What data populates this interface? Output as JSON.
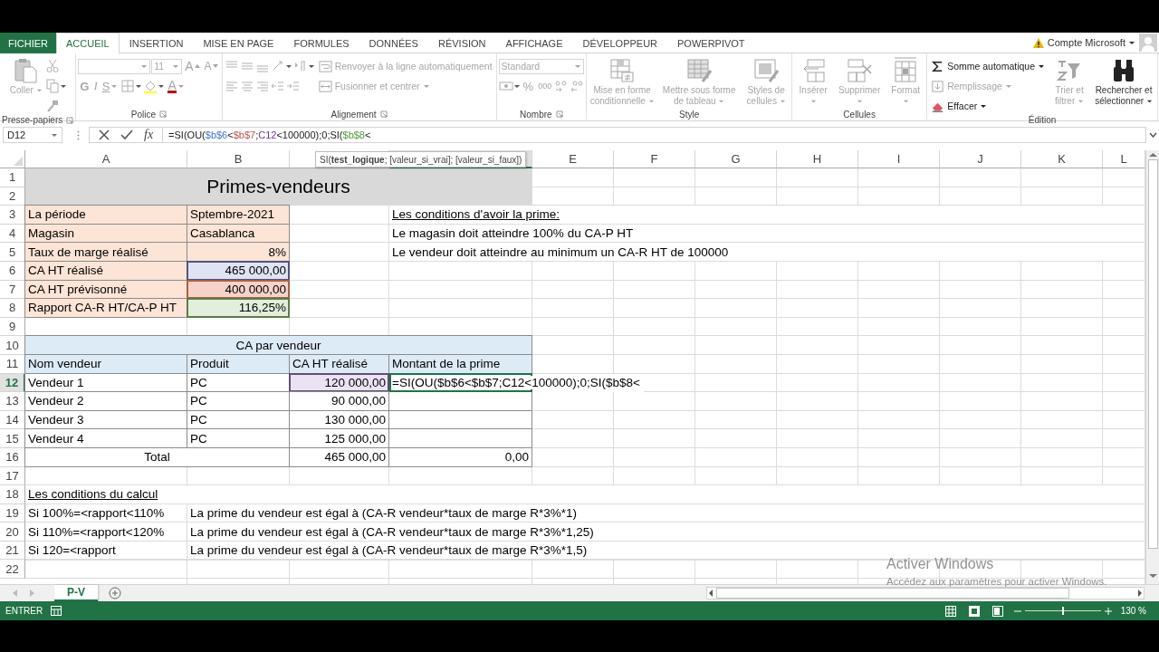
{
  "ribbon": {
    "tabs": [
      {
        "label": "FICHIER",
        "kind": "file",
        "selected": false
      },
      {
        "label": "ACCUEIL",
        "kind": "tab",
        "selected": true
      },
      {
        "label": "INSERTION",
        "kind": "tab",
        "selected": false
      },
      {
        "label": "MISE EN PAGE",
        "kind": "tab",
        "selected": false
      },
      {
        "label": "FORMULES",
        "kind": "tab",
        "selected": false
      },
      {
        "label": "DONNÉES",
        "kind": "tab",
        "selected": false
      },
      {
        "label": "RÉVISION",
        "kind": "tab",
        "selected": false
      },
      {
        "label": "AFFICHAGE",
        "kind": "tab",
        "selected": false
      },
      {
        "label": "DÉVELOPPEUR",
        "kind": "tab",
        "selected": false
      },
      {
        "label": "POWERPIVOT",
        "kind": "tab",
        "selected": false
      }
    ],
    "account": {
      "label": "Compte Microsoft"
    },
    "groups": [
      {
        "name": "Presse-papiers",
        "launcher": true,
        "blocks": [
          {
            "kind": "large",
            "label": "Coller",
            "disabled": true,
            "dropdown": true
          },
          {
            "kind": "rows",
            "rows": [
              [
                {
                  "kind": "icon",
                  "disabled": true
                }
              ],
              [
                {
                  "kind": "icon",
                  "disabled": true,
                  "dropdown": true
                }
              ],
              [
                {
                  "kind": "icon",
                  "disabled": true
                }
              ]
            ]
          }
        ]
      },
      {
        "name": "Police",
        "launcher": true,
        "blocks": [
          {
            "kind": "rows",
            "rows": [
              [
                {
                  "kind": "field",
                  "disabled": true
                },
                {
                  "kind": "field",
                  "value": "11",
                  "disabled": true
                },
                {
                  "kind": "glyph",
                  "label": "A",
                  "disabled": true
                },
                {
                  "kind": "glyph",
                  "label": "A",
                  "disabled": true
                }
              ],
              [
                {
                  "kind": "glyph",
                  "label": "G",
                  "disabled": true
                },
                {
                  "kind": "glyph",
                  "label": "I",
                  "disabled": true
                },
                {
                  "kind": "glyph",
                  "label": "S",
                  "disabled": true,
                  "dropdown": true
                },
                {
                  "kind": "icon",
                  "disabled": true,
                  "dropdown": true
                },
                {
                  "kind": "icon",
                  "disabled": true,
                  "dropdown": true
                },
                {
                  "kind": "glyph",
                  "label": "A",
                  "disabled": true,
                  "dropdown": true
                }
              ]
            ]
          }
        ]
      },
      {
        "name": "Alignement",
        "launcher": true,
        "blocks": [
          {
            "kind": "rows",
            "rows": [
              [
                {
                  "kind": "icon",
                  "disabled": true
                },
                {
                  "kind": "icon",
                  "disabled": true
                },
                {
                  "kind": "icon",
                  "disabled": true
                },
                {
                  "kind": "icon",
                  "disabled": true,
                  "dropdown": true
                },
                {
                  "kind": "icon",
                  "disabled": true,
                  "dropdown": true
                }
              ],
              [
                {
                  "kind": "icon",
                  "disabled": true
                },
                {
                  "kind": "icon",
                  "disabled": true
                },
                {
                  "kind": "icon",
                  "disabled": true
                },
                {
                  "kind": "icon",
                  "disabled": true
                },
                {
                  "kind": "icon",
                  "disabled": true
                }
              ]
            ]
          },
          {
            "kind": "rows",
            "rows": [
              [
                {
                  "kind": "button",
                  "label": "Renvoyer à la ligne automatiquement",
                  "disabled": true
                }
              ],
              [
                {
                  "kind": "button",
                  "label": "Fusionner et centrer",
                  "disabled": true,
                  "dropdown": true
                }
              ]
            ]
          }
        ]
      },
      {
        "name": "Nombre",
        "launcher": true,
        "blocks": [
          {
            "kind": "rows",
            "rows": [
              [
                {
                  "kind": "field",
                  "value": "Standard",
                  "disabled": true
                }
              ],
              [
                {
                  "kind": "icon",
                  "disabled": true,
                  "dropdown": true
                },
                {
                  "kind": "glyph",
                  "label": "%",
                  "disabled": true
                },
                {
                  "kind": "glyph",
                  "label": "000",
                  "disabled": true
                },
                {
                  "kind": "icon",
                  "disabled": true
                },
                {
                  "kind": "icon",
                  "disabled": true
                }
              ]
            ]
          }
        ]
      },
      {
        "name": "Style",
        "launcher": false,
        "blocks": [
          {
            "kind": "large",
            "label": "Mise en forme conditionnelle",
            "disabled": true,
            "dropdown": true
          },
          {
            "kind": "large",
            "label": "Mettre sous forme de tableau",
            "disabled": true,
            "dropdown": true
          },
          {
            "kind": "large",
            "label": "Styles de cellules",
            "disabled": true,
            "dropdown": true
          }
        ]
      },
      {
        "name": "Cellules",
        "launcher": false,
        "blocks": [
          {
            "kind": "large",
            "label": "Insérer",
            "disabled": true,
            "dropdown": true
          },
          {
            "kind": "large",
            "label": "Supprimer",
            "disabled": true,
            "dropdown": true
          },
          {
            "kind": "large",
            "label": "Format",
            "disabled": true,
            "dropdown": true
          }
        ]
      },
      {
        "name": "Édition",
        "launcher": false,
        "blocks": [
          {
            "kind": "rows",
            "rows": [
              [
                {
                  "kind": "button",
                  "label": "Somme automatique",
                  "disabled": false,
                  "dropdown": true
                }
              ],
              [
                {
                  "kind": "button",
                  "label": "Remplissage",
                  "disabled": true,
                  "dropdown": true
                }
              ],
              [
                {
                  "kind": "button",
                  "label": "Effacer",
                  "disabled": false,
                  "dropdown": true
                }
              ]
            ]
          },
          {
            "kind": "large",
            "label": "Trier et filtrer",
            "disabled": true,
            "dropdown": true
          },
          {
            "kind": "large",
            "label": "Rechercher et sélectionner",
            "disabled": false,
            "dropdown": true
          }
        ]
      }
    ]
  },
  "formula_bar": {
    "name_box": "D12",
    "fx": "fx",
    "segments": [
      {
        "text": "=SI(OU("
      },
      {
        "text": "$b$6",
        "color": "#4472c4"
      },
      {
        "text": "<"
      },
      {
        "text": "$b$7",
        "color": "#c0504d"
      },
      {
        "text": ";"
      },
      {
        "text": "C12",
        "color": "#7030a0"
      },
      {
        "text": "<100000);0;SI("
      },
      {
        "text": "$b$8",
        "color": "#4f9a3a"
      },
      {
        "text": "<"
      }
    ]
  },
  "tooltip": "SI(**test_logique**; [valeur_si_vrai]; [valeur_si_faux])",
  "sheet": {
    "columns": [
      {
        "label": "A",
        "selected": false
      },
      {
        "label": "B",
        "selected": false
      },
      {
        "selected": false
      },
      {
        "selected": true
      },
      {
        "label": "E",
        "selected": false
      },
      {
        "label": "F",
        "selected": false
      },
      {
        "label": "G",
        "selected": false
      },
      {
        "label": "H",
        "selected": false
      },
      {
        "label": "I",
        "selected": false
      },
      {
        "label": "J",
        "selected": false
      },
      {
        "label": "K",
        "selected": false
      },
      {
        "label": "L",
        "selected": false
      }
    ],
    "rows": [
      {
        "number": "1",
        "selected": false,
        "cells": [
          {
            "kind": "title",
            "text": "Primes-vendeurs",
            "color": "#d9d9d9",
            "selected": false
          }
        ]
      },
      {
        "number": "2",
        "selected": false
      },
      {
        "number": "3",
        "selected": false,
        "cells": [
          {
            "kind": "boxed",
            "text": "La période",
            "color": "#fce4d6",
            "selected": false
          },
          {
            "kind": "boxed",
            "text": "Sptembre-2021",
            "color": "#fce4d6",
            "selected": false
          },
          {
            "kind": "empty"
          },
          {
            "kind": "note",
            "text": "Les conditions d'avoir la prime:",
            "selected": false
          }
        ]
      },
      {
        "number": "4",
        "selected": false,
        "cells": [
          {
            "kind": "boxed",
            "text": "Magasin",
            "color": "#fce4d6",
            "selected": false
          },
          {
            "kind": "boxed",
            "text": "Casablanca",
            "color": "#fce4d6",
            "selected": false
          },
          {
            "kind": "empty"
          },
          {
            "kind": "text",
            "text": "Le magasin doit atteindre 100% du CA-P HT",
            "selected": false
          }
        ]
      },
      {
        "number": "5",
        "selected": false,
        "cells": [
          {
            "kind": "boxed",
            "text": "Taux de marge réalisé",
            "color": "#fce4d6",
            "selected": false
          },
          {
            "kind": "number",
            "text": "8%",
            "color": "#fce4d6",
            "selected": false
          },
          {
            "kind": "empty"
          },
          {
            "kind": "text",
            "text": "Le vendeur doit atteindre au minimum un CA-R HT de 100000",
            "selected": false
          }
        ]
      },
      {
        "number": "6",
        "selected": false,
        "cells": [
          {
            "kind": "boxed",
            "text": "CA HT réalisé",
            "color": "#fce4d6",
            "selected": false
          },
          {
            "kind": "number",
            "text": "465 000,00",
            "color": "#dfe3f3",
            "highlighted": true,
            "selected": false
          }
        ]
      },
      {
        "number": "7",
        "selected": false,
        "cells": [
          {
            "kind": "boxed",
            "text": "CA HT prévisonné",
            "color": "#fce4d6",
            "selected": false
          },
          {
            "kind": "number",
            "text": "400 000,00",
            "color": "#f6d3c8",
            "highlighted": true,
            "selected": false
          }
        ]
      },
      {
        "number": "8",
        "selected": false,
        "cells": [
          {
            "kind": "boxed",
            "text": "Rapport CA-R HT/CA-P HT",
            "color": "#fce4d6",
            "selected": false
          },
          {
            "kind": "number",
            "text": "116,25%",
            "color": "#e2efda",
            "highlighted": true,
            "selected": false
          }
        ]
      },
      {
        "number": "9",
        "selected": false
      },
      {
        "number": "10",
        "selected": false,
        "cells": [
          {
            "kind": "band",
            "text": "CA par vendeur",
            "color": "#ddebf7",
            "selected": false
          }
        ]
      },
      {
        "number": "11",
        "selected": false,
        "cells": [
          {
            "kind": "boxed",
            "text": "Nom vendeur",
            "color": "#ddebf7",
            "selected": false
          },
          {
            "kind": "boxed",
            "text": "Produit",
            "color": "#ddebf7",
            "selected": false
          },
          {
            "kind": "boxed",
            "text": "CA HT réalisé",
            "color": "#ddebf7",
            "selected": false
          },
          {
            "kind": "boxed",
            "text": "Montant de la prime",
            "color": "#ddebf7",
            "selected": false
          }
        ]
      },
      {
        "number": "12",
        "selected": true,
        "cells": [
          {
            "kind": "boxed",
            "text": "Vendeur 1",
            "selected": false
          },
          {
            "kind": "boxed",
            "text": "PC",
            "selected": false
          },
          {
            "kind": "number",
            "text": "120 000,00",
            "color": "#ebe3f3",
            "highlighted": true,
            "selected": false
          },
          {
            "kind": "boxed",
            "text": "=SI(OU($b$6<$b$7;C12<100000);0;SI($b$8<",
            "selected": true
          }
        ]
      },
      {
        "number": "13",
        "selected": false,
        "cells": [
          {
            "kind": "boxed",
            "text": "Vendeur 2",
            "selected": false
          },
          {
            "kind": "boxed",
            "text": "PC",
            "selected": false
          },
          {
            "kind": "number",
            "text": "90 000,00",
            "selected": false
          },
          {
            "kind": "boxed",
            "selected": false
          }
        ]
      },
      {
        "number": "14",
        "selected": false,
        "cells": [
          {
            "kind": "boxed",
            "text": "Vendeur 3",
            "selected": false
          },
          {
            "kind": "boxed",
            "text": "PC",
            "selected": false
          },
          {
            "kind": "number",
            "text": "130 000,00",
            "selected": false
          },
          {
            "kind": "boxed",
            "selected": false
          }
        ]
      },
      {
        "number": "15",
        "selected": false,
        "cells": [
          {
            "kind": "boxed",
            "text": "Vendeur 4",
            "selected": false
          },
          {
            "kind": "boxed",
            "text": "PC",
            "selected": false
          },
          {
            "kind": "number",
            "text": "125 000,00",
            "selected": false
          },
          {
            "kind": "boxed",
            "selected": false
          }
        ]
      },
      {
        "number": "16",
        "selected": false,
        "cells": [
          {
            "kind": "total",
            "text": "Total",
            "selected": false
          },
          {
            "kind": "number",
            "text": "465 000,00",
            "selected": false
          },
          {
            "kind": "number",
            "text": "0,00",
            "selected": false
          }
        ]
      },
      {
        "number": "17",
        "selected": false
      },
      {
        "number": "18",
        "selected": false,
        "cells": [
          {
            "kind": "note",
            "text": "Les conditions du calcul",
            "selected": false
          }
        ]
      },
      {
        "number": "19",
        "selected": false,
        "cells": [
          {
            "kind": "text",
            "text": "Si 100%=<rapport<110%",
            "selected": false
          },
          {
            "kind": "text",
            "text": "La prime du vendeur est égal à (CA-R vendeur*taux de marge R*3%*1)",
            "selected": false
          }
        ]
      },
      {
        "number": "20",
        "selected": false,
        "cells": [
          {
            "kind": "text",
            "text": "Si 110%=<rapport<120%",
            "selected": false
          },
          {
            "kind": "text",
            "text": "La prime du vendeur est égal à (CA-R vendeur*taux de marge R*3%*1,25)",
            "selected": false
          }
        ]
      },
      {
        "number": "21",
        "selected": false,
        "cells": [
          {
            "kind": "text",
            "text": "Si 120=<rapport",
            "selected": false
          },
          {
            "kind": "text",
            "text": "La prime du vendeur est égal à (CA-R vendeur*taux de marge R*3%*1,5)",
            "selected": false
          }
        ]
      },
      {
        "number": "22",
        "selected": false
      }
    ]
  },
  "activation_notice": {
    "title": "Activer Windows",
    "text": "Accédez aux paramètres pour activer Windows."
  },
  "sheet_tabs": [
    {
      "label": "P-V",
      "selected": true
    }
  ],
  "status_bar": {
    "mode": "ENTRER",
    "zoom_slider": {
      "level": 0.5
    },
    "zoom": "130 %"
  }
}
